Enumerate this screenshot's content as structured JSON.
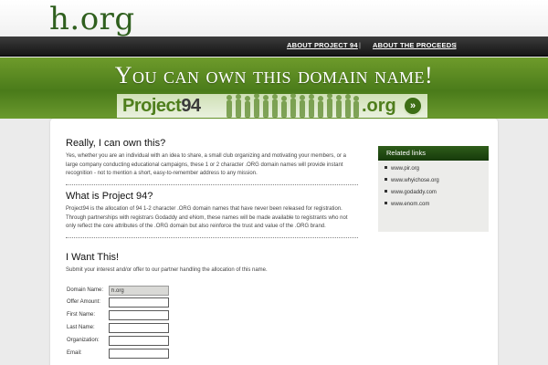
{
  "site": {
    "logo": "h.org"
  },
  "nav": [
    {
      "label": "ABOUT PROJECT 94"
    },
    {
      "label": "ABOUT THE PROCEEDS"
    }
  ],
  "banner": {
    "headline": "You can own this domain name!",
    "project_word": "Project",
    "project_num": "94",
    "org_word": ".org",
    "arrow": "»"
  },
  "sections": {
    "own": {
      "title": "Really, I can own this?",
      "text": "Yes, whether you are an individual with an idea to share, a small club organizing and motivating your members, or a large company conducting educational campaigns, these 1 or 2 character .ORG domain names will provide instant recognition - not to mention a short, easy-to-remember address to any mission."
    },
    "what": {
      "title": "What is Project 94?",
      "text": "Project94 is the allocation of 94 1-2 character .ORG domain names that have never been released for registration. Through partnerships with registrars Godaddy and eNom, these names will be made available to registrants who not only reflect the core attributes of the .ORG domain but also reinforce the trust and value of the .ORG brand."
    },
    "want": {
      "title": "I Want This!",
      "text": "Submit your interest and/or offer to our partner handling the allocation of this name."
    }
  },
  "form": {
    "fields": [
      {
        "label": "Domain Name:",
        "value": "h.org"
      },
      {
        "label": "Offer Amount:",
        "value": ""
      },
      {
        "label": "First Name:",
        "value": ""
      },
      {
        "label": "Last Name:",
        "value": ""
      },
      {
        "label": "Organization:",
        "value": ""
      },
      {
        "label": "Email:",
        "value": ""
      }
    ]
  },
  "sidebar": {
    "title": "Related links",
    "links": [
      {
        "label": "www.pir.org"
      },
      {
        "label": "www.whyichose.org"
      },
      {
        "label": "www.godaddy.com"
      },
      {
        "label": "www.enom.com"
      }
    ]
  },
  "colors": {
    "brand_green": "#2f5f1e",
    "banner_green": "#5a8a22",
    "nav_dark": "#1e1e1e"
  }
}
